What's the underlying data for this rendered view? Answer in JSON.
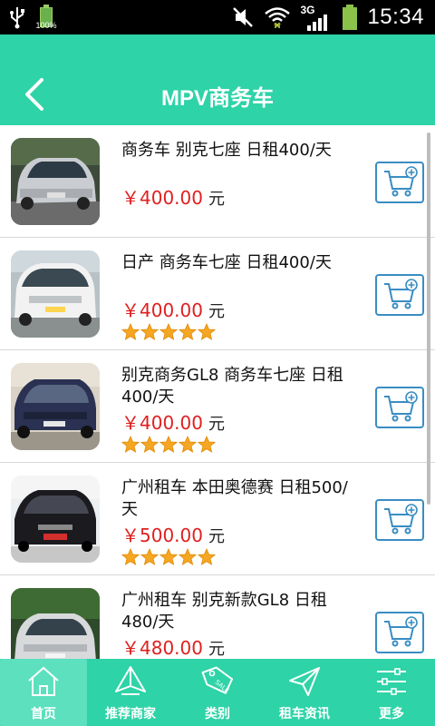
{
  "status_bar": {
    "battery_percent": "100%",
    "network": "3G",
    "time": "15:34"
  },
  "header": {
    "title": "MPV商务车"
  },
  "colors": {
    "brand": "#2ed3a7",
    "price": "#e02020",
    "cart_border": "#3a8dc3",
    "star": "#f5a623"
  },
  "listings": [
    {
      "title": "商务车  别克七座  日租400/天",
      "price": "￥400.00",
      "unit": "元",
      "rating": null
    },
    {
      "title": "日产 商务车七座 日租400/天",
      "price": "￥400.00",
      "unit": "元",
      "rating": 5
    },
    {
      "title": "别克商务GL8  商务车七座  日租400/天",
      "price": "￥400.00",
      "unit": "元",
      "rating": 5
    },
    {
      "title": "广州租车 本田奥德赛 日租500/天",
      "price": "￥500.00",
      "unit": "元",
      "rating": 5
    },
    {
      "title": "广州租车 别克新款GL8 日租480/天",
      "price": "￥480.00",
      "unit": "元",
      "rating": null
    }
  ],
  "nav": [
    {
      "label": "首页",
      "icon": "home-icon",
      "active": true
    },
    {
      "label": "推荐商家",
      "icon": "recommend-icon",
      "active": false
    },
    {
      "label": "类别",
      "icon": "tag-icon",
      "active": false
    },
    {
      "label": "租车资讯",
      "icon": "send-icon",
      "active": false
    },
    {
      "label": "更多",
      "icon": "sliders-icon",
      "active": false
    }
  ]
}
